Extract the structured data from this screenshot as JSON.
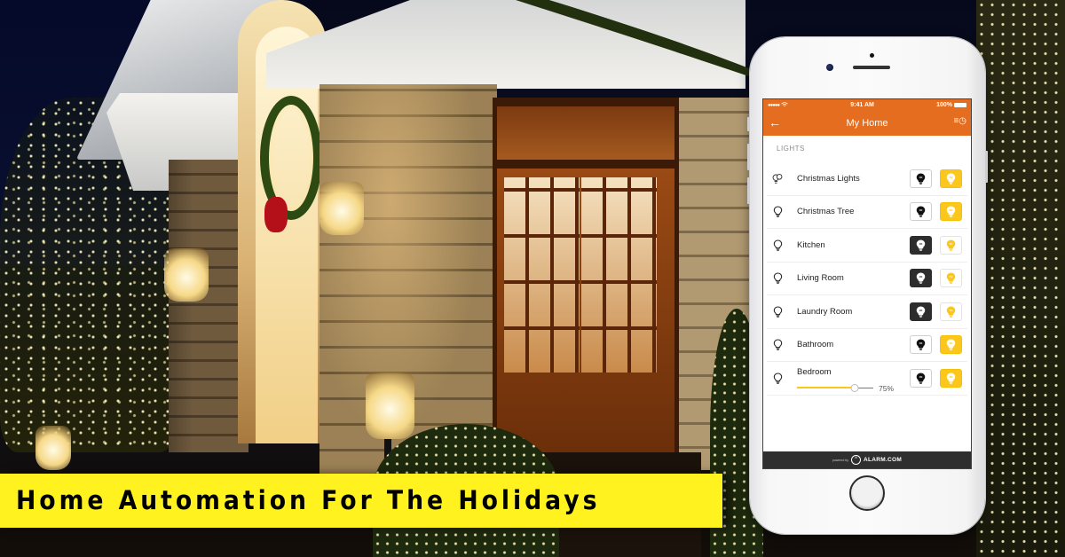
{
  "headline": "Home Automation For The Holidays",
  "colors": {
    "banner": "#fff21f",
    "app_header": "#e56d1f",
    "on_button": "#fcc71c",
    "off_button_active": "#2d2d2d",
    "footer": "#2f2f30"
  },
  "phone": {
    "status_bar": {
      "signal": "●●●●●",
      "wifi_icon": "wifi-icon",
      "time": "9:41 AM",
      "battery": "100%"
    },
    "nav": {
      "back_icon": "←",
      "title": "My Home",
      "schedule_icon": "≡◷"
    },
    "section": "LIGHTS",
    "lights": [
      {
        "name": "Christmas Lights",
        "icon": "multi-bulb",
        "state": "on"
      },
      {
        "name": "Christmas Tree",
        "icon": "bulb",
        "state": "on"
      },
      {
        "name": "Kitchen",
        "icon": "bulb",
        "state": "off"
      },
      {
        "name": "Living Room",
        "icon": "bulb",
        "state": "off"
      },
      {
        "name": "Laundry Room",
        "icon": "bulb",
        "state": "off"
      },
      {
        "name": "Bathroom",
        "icon": "bulb",
        "state": "on"
      },
      {
        "name": "Bedroom",
        "icon": "bulb",
        "state": "on",
        "dimmer_percent": 75,
        "dimmer_label": "75%"
      }
    ],
    "footer": {
      "powered_by": "powered by",
      "brand": "ALARM.COM"
    }
  }
}
